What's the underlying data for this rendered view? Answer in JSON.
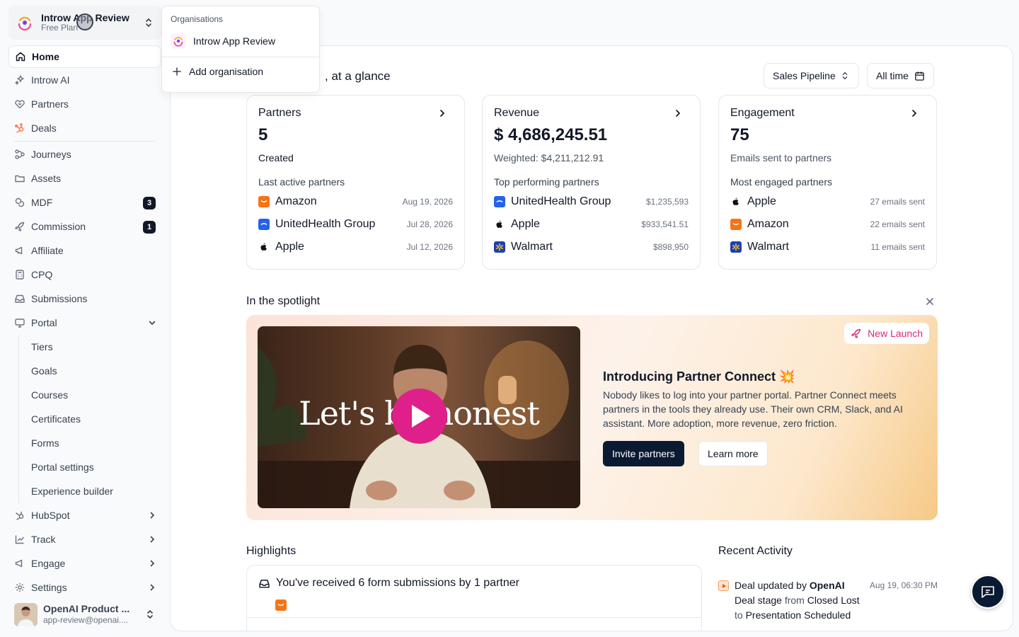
{
  "org": {
    "name": "Introw App Review",
    "plan": "Free Plan"
  },
  "org_menu": {
    "title": "Organisations",
    "items": [
      "Introw App Review"
    ],
    "add_label": "Add organisation"
  },
  "nav": {
    "home": "Home",
    "introw_ai": "Introw AI",
    "partners": "Partners",
    "deals": "Deals",
    "journeys": "Journeys",
    "assets": "Assets",
    "mdf": "MDF",
    "mdf_badge": "3",
    "commission": "Commission",
    "commission_badge": "1",
    "affiliate": "Affiliate",
    "cpq": "CPQ",
    "submissions": "Submissions",
    "portal": "Portal",
    "portal_sub": [
      "Tiers",
      "Goals",
      "Courses",
      "Certificates",
      "Forms",
      "Portal settings",
      "Experience builder"
    ],
    "hubspot": "HubSpot",
    "track": "Track",
    "engage": "Engage",
    "settings": "Settings"
  },
  "user": {
    "name": "OpenAI Product ...",
    "email": "app-review@openai...."
  },
  "main": {
    "heading": ", at a glance",
    "pipeline_label": "Sales Pipeline",
    "range_label": "All time"
  },
  "cards": [
    {
      "title": "Partners",
      "value": "5",
      "sub": "Created",
      "list_title": "Last active partners",
      "rows": [
        {
          "name": "Amazon",
          "val": "Aug 19, 2026",
          "logo": "amazon"
        },
        {
          "name": "UnitedHealth Group",
          "val": "Jul 28, 2026",
          "logo": "unitedhealth"
        },
        {
          "name": "Apple",
          "val": "Jul 12, 2026",
          "logo": "apple"
        }
      ]
    },
    {
      "title": "Revenue",
      "value": "$ 4,686,245.51",
      "sub": "Weighted: $4,211,212.91",
      "list_title": "Top performing partners",
      "rows": [
        {
          "name": "UnitedHealth Group",
          "val": "$1,235,593",
          "logo": "unitedhealth"
        },
        {
          "name": "Apple",
          "val": "$933,541.51",
          "logo": "apple"
        },
        {
          "name": "Walmart",
          "val": "$898,950",
          "logo": "walmart"
        }
      ]
    },
    {
      "title": "Engagement",
      "value": "75",
      "sub": "Emails sent to partners",
      "list_title": "Most engaged partners",
      "rows": [
        {
          "name": "Apple",
          "val": "27 emails sent",
          "logo": "apple"
        },
        {
          "name": "Amazon",
          "val": "22 emails sent",
          "logo": "amazon"
        },
        {
          "name": "Walmart",
          "val": "11 emails sent",
          "logo": "walmart"
        }
      ]
    }
  ],
  "spotlight": {
    "title": "In the spotlight",
    "badge": "New Launch",
    "video_text": "Let's be honest",
    "heading": "Introducing Partner Connect 💥",
    "body": "Nobody likes to log into your partner portal. Partner Connect meets partners in the tools they already use. Their own CRM, Slack, and AI assistant. More adoption, more revenue, zero friction.",
    "primary": "Invite partners",
    "secondary": "Learn more"
  },
  "highlights": {
    "title": "Highlights",
    "first": "You've received 6 form submissions by 1 partner"
  },
  "recent": {
    "title": "Recent Activity",
    "item": {
      "prefix": "Deal updated by ",
      "actor": "OpenAI",
      "time": "Aug 19, 06:30 PM",
      "field": "Deal stage",
      "from_word": " from ",
      "from_val": "Closed Lost",
      "to_word": "to ",
      "to_val": "Presentation Scheduled"
    }
  },
  "colors": {
    "accent": "#e0208a",
    "dark": "#0b1a33",
    "hubspot": "#ff7a59",
    "amazon": "#f97316",
    "unitedhealth": "#1d4ed8",
    "walmart": "#1e40af"
  }
}
